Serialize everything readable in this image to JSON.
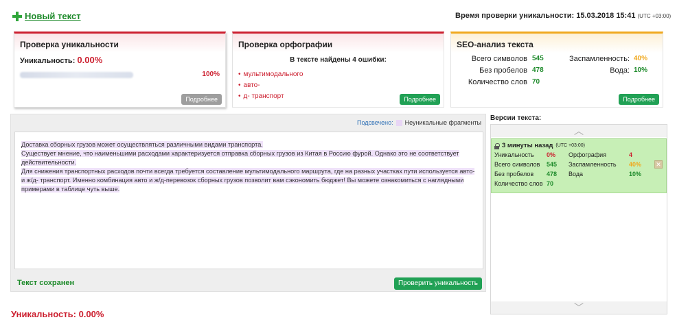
{
  "header": {
    "new_text_label": "Новый текст",
    "check_time_label": "Время проверки уникальности: 15.03.2018 15:41",
    "check_time_tz": "(UTC +03:00)"
  },
  "uniq_card": {
    "title": "Проверка уникальности",
    "uniq_label": "Уникальность:",
    "uniq_value": "0.00%",
    "source_percent": "100%",
    "more_label": "Подробнее"
  },
  "spell_card": {
    "title": "Проверка орфографии",
    "found_text": "В тексте найдены 4 ошибки:",
    "errors": [
      "мультимодального",
      "авто-",
      "д- транспорт"
    ],
    "more_label": "Подробнее"
  },
  "seo_card": {
    "title": "SEO-анализ текста",
    "chars_label": "Всего символов",
    "chars_value": "545",
    "nospace_label": "Без пробелов",
    "nospace_value": "478",
    "words_label": "Количество слов",
    "words_value": "70",
    "spam_label": "Заспамленность:",
    "spam_value": "40%",
    "water_label": "Вода:",
    "water_value": "10%",
    "more_label": "Подробнее"
  },
  "editor": {
    "legend_link": "Подсвечено:",
    "legend_text": "Неуникальные фрагменты",
    "lines": [
      "Доставка сборных грузов может осуществляться различными видами транспорта.",
      "Существует мнение, что наименьшими расходами характеризуется отправка сборных грузов из Китая в Россию фурой. Однако это не соответствует действительности.",
      "Для снижения транспортных расходов почти всегда требуется составление мультимодального маршрута, где на разных участках пути используется авто- и ж/д- транспорт. Именно комбинация авто и ж/д-перевозок сборных грузов позволит вам сэкономить бюджет! Вы можете ознакомиться с наглядными примерами в таблице чуть выше."
    ],
    "saved_label": "Текст сохранен",
    "check_button": "Проверить уникальность"
  },
  "bottom": {
    "uniq_text": "Уникальность: 0.00%"
  },
  "versions": {
    "title": "Версии текста:",
    "item": {
      "time": "3 минуты назад",
      "tz": "(UTC +03:00)",
      "uniq_label": "Уникальность",
      "uniq_value": "0%",
      "spell_label": "Орфография",
      "spell_value": "4",
      "chars_label": "Всего символов",
      "chars_value": "545",
      "spam_label": "Заспамленность",
      "spam_value": "40%",
      "nospace_label": "Без пробелов",
      "nospace_value": "478",
      "water_label": "Вода",
      "water_value": "10%",
      "words_label": "Количество слов",
      "words_value": "70"
    }
  },
  "colors": {
    "green": "#1d8a2a",
    "red": "#cc1f2f",
    "orange": "#f0a81d",
    "button_green": "#21a155"
  }
}
